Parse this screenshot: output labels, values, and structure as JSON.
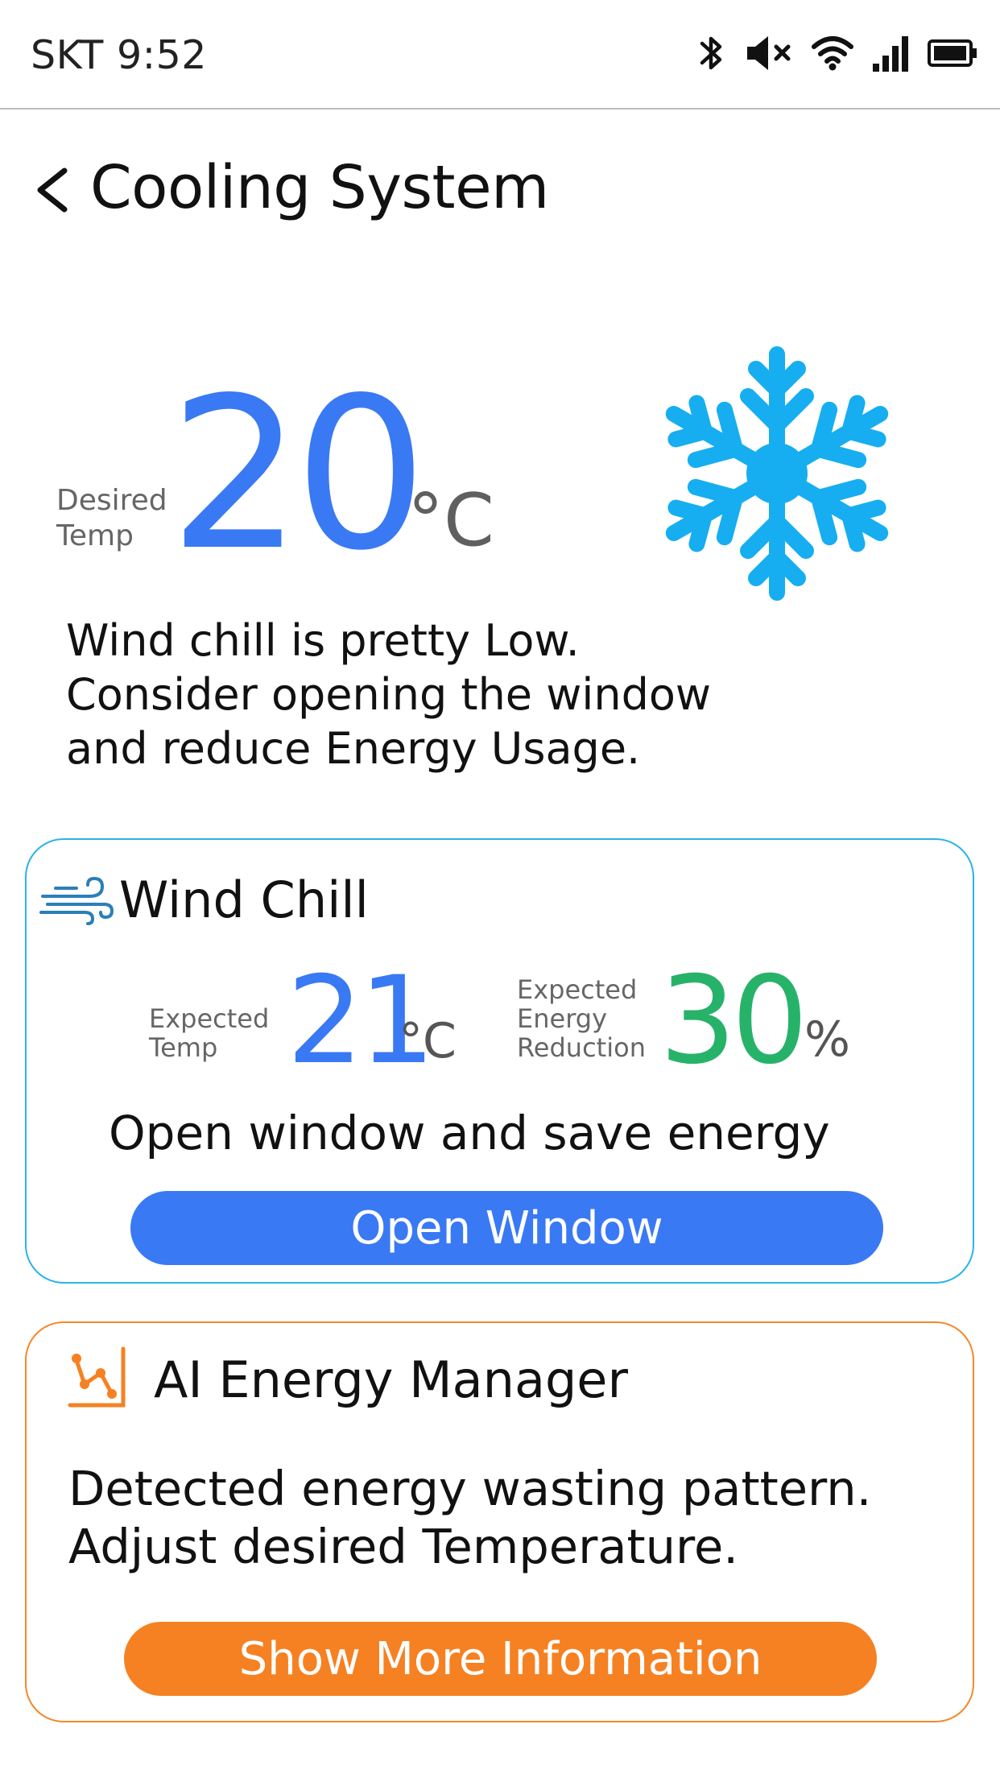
{
  "status_bar": {
    "carrier_time": "SKT 9:52",
    "icons": [
      "bluetooth-icon",
      "mute-icon",
      "wifi-icon",
      "signal-icon",
      "battery-icon"
    ]
  },
  "header": {
    "back_icon": "chevron-left-icon",
    "title": "Cooling System"
  },
  "desired_temp": {
    "label_line1": "Desired",
    "label_line2": "Temp",
    "value": "20",
    "unit": "°C",
    "icon": "snowflake-icon"
  },
  "advice": {
    "line1": "Wind chill is pretty Low.",
    "line2": "Consider opening the window",
    "line3": "and reduce Energy Usage."
  },
  "wind_chill_card": {
    "icon": "wind-icon",
    "title": "Wind Chill",
    "expected_temp_label1": "Expected",
    "expected_temp_label2": "Temp",
    "expected_temp_value": "21",
    "expected_temp_unit": "°C",
    "reduction_label1": "Expected",
    "reduction_label2": "Energy",
    "reduction_label3": "Reduction",
    "reduction_value": "30",
    "reduction_unit": "%",
    "message": "Open window and save energy",
    "button_label": "Open Window"
  },
  "ai_card": {
    "icon": "chart-icon",
    "title": "AI Energy Manager",
    "line1": "Detected energy wasting pattern.",
    "line2": "Adjust desired Temperature.",
    "button_label": "Show More Information"
  },
  "colors": {
    "accent_blue": "#3a79f4",
    "accent_green": "#27b26a",
    "accent_orange": "#f68122",
    "snowflake": "#16aef0",
    "wind_border": "#2ab3e8"
  }
}
